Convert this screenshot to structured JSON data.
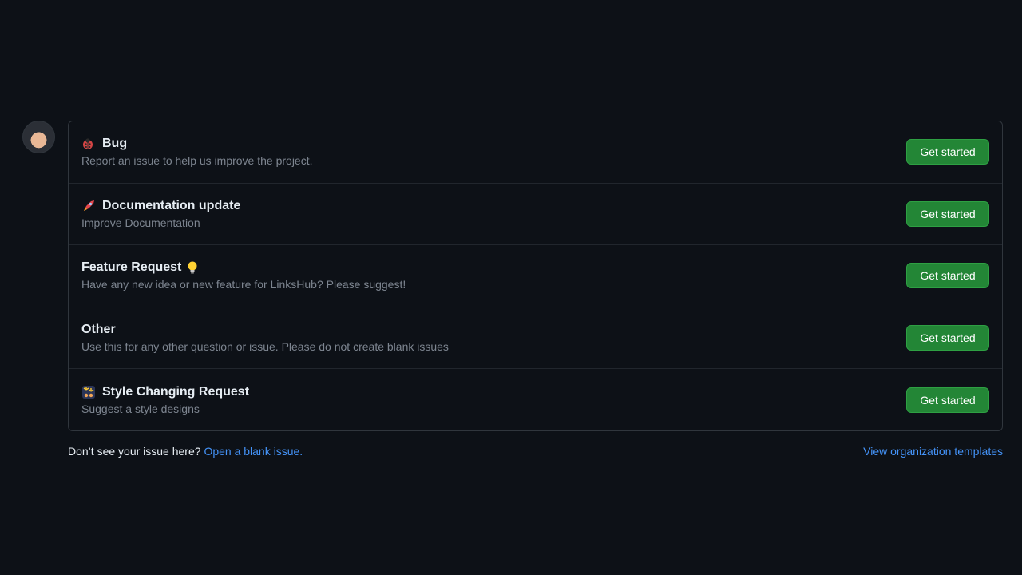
{
  "templates": [
    {
      "emoji": "ladybug-icon",
      "title": "Bug",
      "description": "Report an issue to help us improve the project.",
      "button": "Get started"
    },
    {
      "emoji": "rocket-icon",
      "title": "Documentation update",
      "description": "Improve Documentation",
      "button": "Get started"
    },
    {
      "emoji": "light-bulb-icon",
      "title": "Feature Request",
      "description": "Have any new idea or new feature for LinksHub? Please suggest!",
      "button": "Get started"
    },
    {
      "emoji": "",
      "title": "Other",
      "description": "Use this for any other question or issue. Please do not create blank issues",
      "button": "Get started"
    },
    {
      "emoji": "fireworks-icon",
      "title": "Style Changing Request",
      "description": "Suggest a style designs",
      "button": "Get started"
    }
  ],
  "footer": {
    "prompt": "Don’t see your issue here?",
    "blank_issue_link": "Open a blank issue.",
    "org_templates_link": "View organization templates"
  },
  "colors": {
    "background": "#0d1117",
    "border": "#30363d",
    "button": "#238636",
    "link": "#4493f8",
    "muted_text": "#7d8590"
  }
}
